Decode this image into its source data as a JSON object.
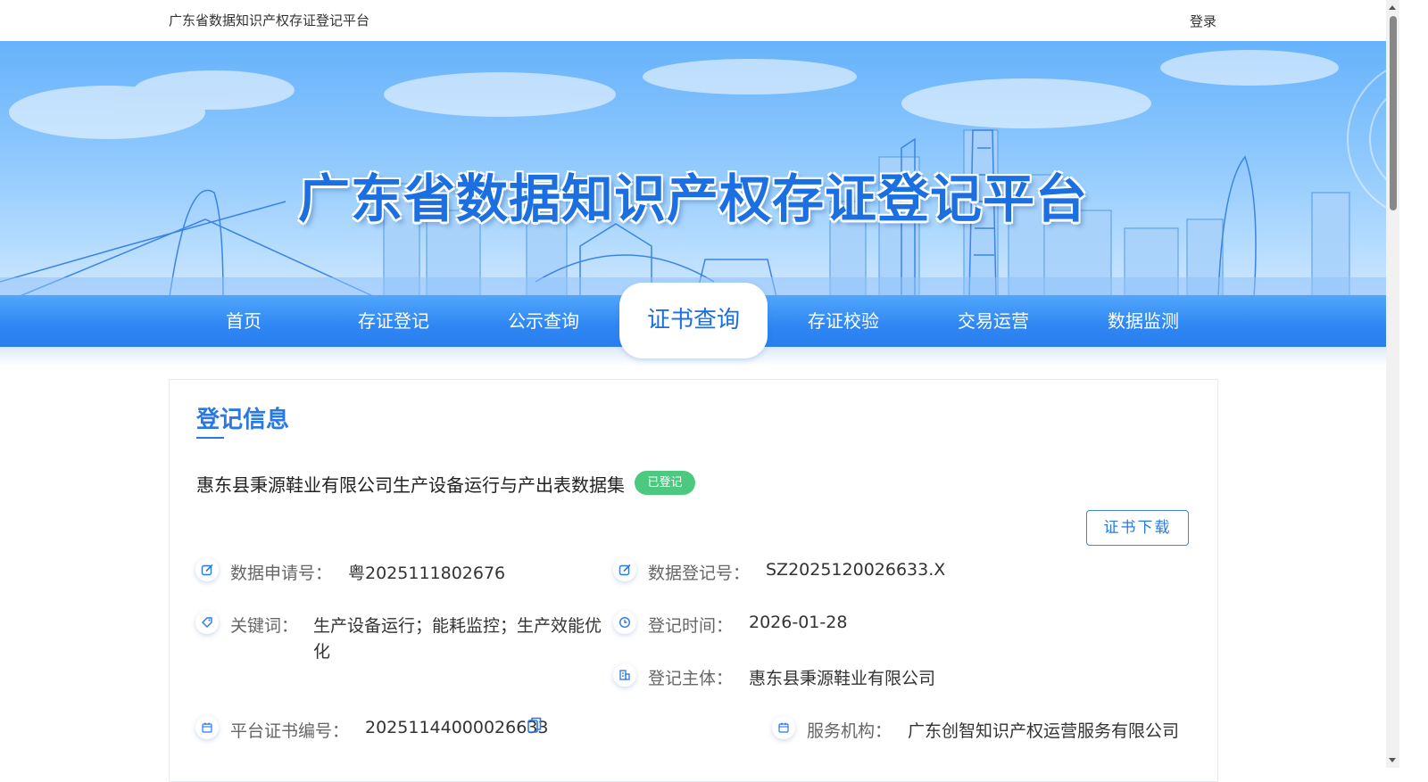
{
  "topbar": {
    "site_name": "广东省数据知识产权存证登记平台",
    "login_label": "登录"
  },
  "banner": {
    "title": "广东省数据知识产权存证登记平台"
  },
  "nav": {
    "items": [
      {
        "label": "首页"
      },
      {
        "label": "存证登记"
      },
      {
        "label": "公示查询"
      },
      {
        "label": "证书查询",
        "active": true
      },
      {
        "label": "存证校验"
      },
      {
        "label": "交易运营"
      },
      {
        "label": "数据监测"
      }
    ]
  },
  "section": {
    "title": "登记信息"
  },
  "dataset": {
    "title": "惠东县秉源鞋业有限公司生产设备运行与产出表数据集",
    "status": "已登记",
    "download_label": "证书下载"
  },
  "fields": {
    "application_no": {
      "label": "数据申请号：",
      "value": "粤2025111802676",
      "icon": "edit-icon"
    },
    "registration_no": {
      "label": "数据登记号：",
      "value": "SZ2025120026633.X",
      "icon": "edit-icon"
    },
    "keywords": {
      "label": "关键词：",
      "value_line1": "生产设备运行；能耗监控；生产效能优",
      "value_line2": "化",
      "icon": "tag-icon"
    },
    "registration_time": {
      "label": "登记时间：",
      "value": "2026-01-28",
      "icon": "clock-icon"
    },
    "registrant": {
      "label": "登记主体：",
      "value": "惠东县秉源鞋业有限公司",
      "icon": "organization-icon"
    },
    "certificate_no": {
      "label": "平台证书编号：",
      "value": "20251144000026633",
      "icon": "calendar-icon"
    },
    "service_org": {
      "label": "服务机构：",
      "value": "广东创智知识产权运营服务有限公司",
      "icon": "calendar-icon"
    }
  },
  "colors": {
    "accent": "#2a78e4",
    "nav_blue": "#2f86f2",
    "status_green": "#4cc97f"
  }
}
